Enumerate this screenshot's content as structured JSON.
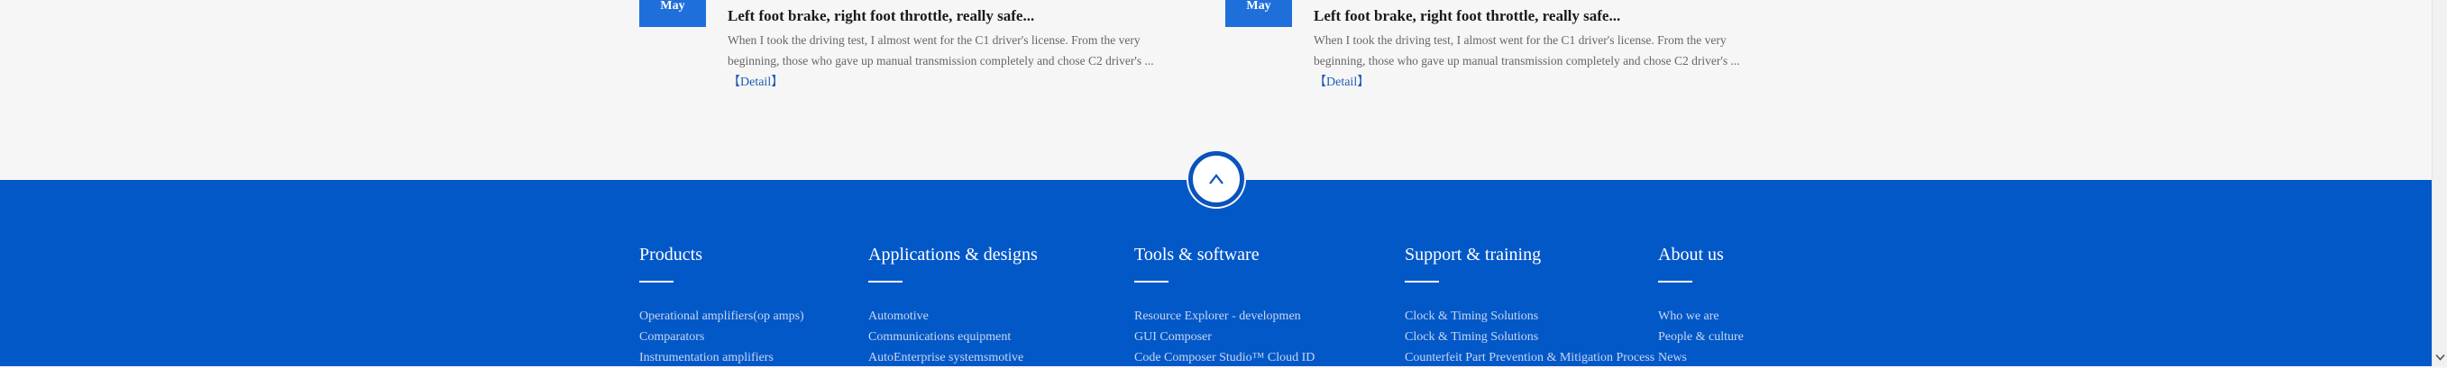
{
  "news": [
    {
      "date": "May",
      "title": "Left foot brake, right foot throttle, really safe...",
      "excerpt": "When I took the driving test, I almost went for the C1 driver's license. From the very beginning, those who gave up manual transmission completely and chose C2 driver's ...",
      "detail": "【Detail】"
    },
    {
      "date": "May",
      "title": "Left foot brake, right foot throttle, really safe...",
      "excerpt": "When I took the driving test, I almost went for the C1 driver's license. From the very beginning, those who gave up manual transmission completely and chose C2 driver's ...",
      "detail": "【Detail】"
    }
  ],
  "back_to_top": {
    "icon": "chevron-up-icon",
    "glyph": "^"
  },
  "footer": {
    "columns": [
      {
        "title": "Products",
        "links": [
          "Operational amplifiers(op amps)",
          "Comparators",
          "Instrumentation amplifiers"
        ]
      },
      {
        "title": "Applications & designs",
        "links": [
          "Automotive",
          "Communications equipment",
          "AutoEnterprise systemsmotive"
        ]
      },
      {
        "title": "Tools & software",
        "links": [
          "Resource Explorer - developmen",
          "GUI Composer",
          "Code Composer Studio™ Cloud ID"
        ]
      },
      {
        "title": "Support & training",
        "links": [
          "Clock & Timing Solutions",
          "Clock & Timing Solutions",
          "Counterfeit Part Prevention & Mitigation Process"
        ]
      },
      {
        "title": "About us",
        "links": [
          "Who we are",
          "People & culture",
          "News"
        ]
      }
    ]
  },
  "colors": {
    "page_bg": "#f6f6f6",
    "footer_bg": "#0358c8",
    "date_box": "#1e6fd9",
    "link_blue": "#1e5bb8",
    "footer_link": "#c7d7ef"
  },
  "scrollbar": {
    "down_icon": "chevron-down-icon"
  }
}
